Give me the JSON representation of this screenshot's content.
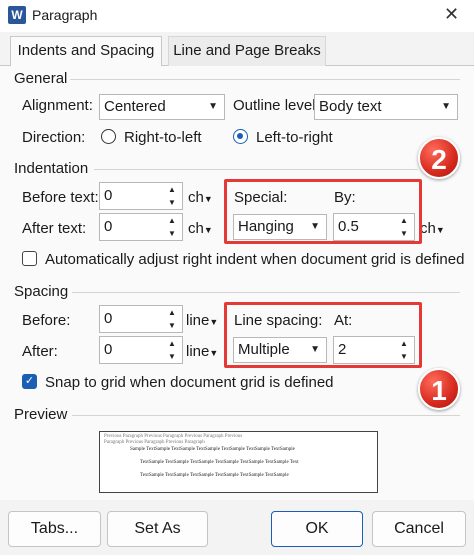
{
  "window": {
    "title": "Paragraph",
    "icon_letter": "W"
  },
  "tabs": [
    {
      "label": "Indents and Spacing",
      "active": true
    },
    {
      "label": "Line and Page Breaks",
      "active": false
    }
  ],
  "general": {
    "section_label": "General",
    "alignment_label": "Alignment:",
    "alignment_value": "Centered",
    "outline_label": "Outline level:",
    "outline_value": "Body text",
    "direction_label": "Direction:",
    "rtl_label": "Right-to-left",
    "ltr_label": "Left-to-right"
  },
  "indentation": {
    "section_label": "Indentation",
    "before_label": "Before text:",
    "before_value": "0",
    "before_unit": "ch",
    "after_label": "After text:",
    "after_value": "0",
    "after_unit": "ch",
    "special_label": "Special:",
    "special_value": "Hanging",
    "by_label": "By:",
    "by_value": "0.5",
    "by_unit": "ch",
    "auto_adjust_label": "Automatically adjust right indent when document grid is defined"
  },
  "spacing": {
    "section_label": "Spacing",
    "before_label": "Before:",
    "before_value": "0",
    "before_unit": "line",
    "after_label": "After:",
    "after_value": "0",
    "after_unit": "line",
    "line_spacing_label": "Line spacing:",
    "line_spacing_value": "Multiple",
    "at_label": "At:",
    "at_value": "2",
    "snap_label": "Snap to grid when document grid is defined"
  },
  "preview": {
    "section_label": "Preview",
    "prev_para_1": "Previous Paragraph Previous Paragraph Previous Paragraph Previous",
    "prev_para_2": "Paragraph Previous Paragraph Previous Paragraph",
    "sample_1": "Sample TextSample TextSample TextSample TextSample TextSample TextSample",
    "sample_2": "TextSample TextSample TextSample TextSample TextSample TextSample Text",
    "sample_3": "TextSample TextSample TextSample TextSample TextSample TextSample"
  },
  "annotations": {
    "badge_1": "1",
    "badge_2": "2"
  },
  "buttons": {
    "tabs": "Tabs...",
    "default": "Set As Default",
    "ok": "OK",
    "cancel": "Cancel"
  },
  "colors": {
    "accent": "#1a5fb4",
    "highlight": "#e53935",
    "word_icon": "#2b579a"
  },
  "state": {
    "auto_adjust_checked": false,
    "snap_checked": true,
    "direction_selected": "ltr"
  }
}
